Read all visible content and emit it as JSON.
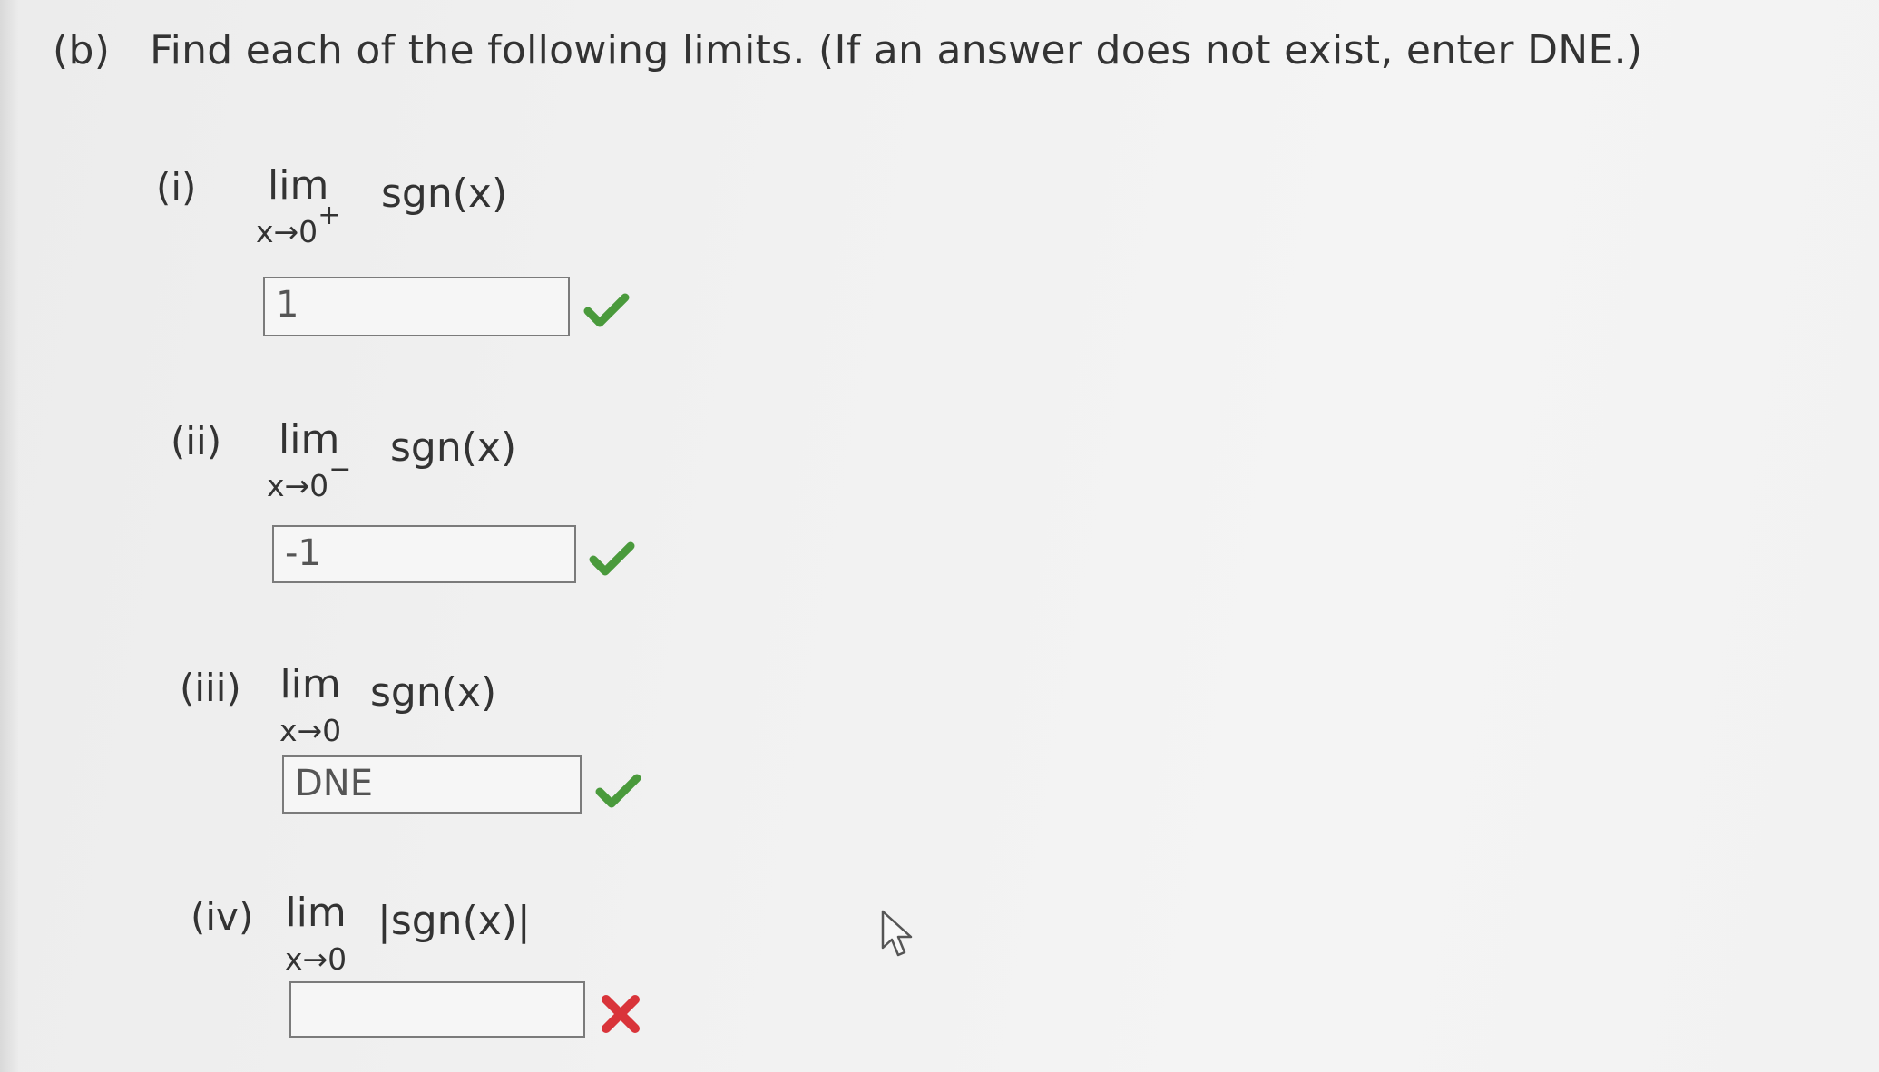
{
  "instruction": {
    "part_label": "(b)",
    "text": "Find each of the following limits. (If an answer does not exist, enter DNE.)"
  },
  "items": [
    {
      "label": "(i)",
      "lim_word": "lim",
      "subscript": "x→0",
      "superscript": "+",
      "function": "sgn(x)",
      "answer": "1",
      "status": "correct"
    },
    {
      "label": "(ii)",
      "lim_word": "lim",
      "subscript": "x→0",
      "superscript": "−",
      "function": "sgn(x)",
      "answer": "-1",
      "status": "correct"
    },
    {
      "label": "(iii)",
      "lim_word": "lim",
      "subscript": "x→0",
      "superscript": "",
      "function": "sgn(x)",
      "answer": "DNE",
      "status": "correct"
    },
    {
      "label": "(iv)",
      "lim_word": "lim",
      "subscript": "x→0",
      "superscript": "",
      "function": "|sgn(x)|",
      "answer": "",
      "status": "incorrect"
    }
  ],
  "icons": {
    "correct": "check-icon",
    "incorrect": "x-icon",
    "cursor": "mouse-pointer-icon"
  },
  "colors": {
    "correct": "#4a9a3c",
    "incorrect": "#d9343a"
  }
}
